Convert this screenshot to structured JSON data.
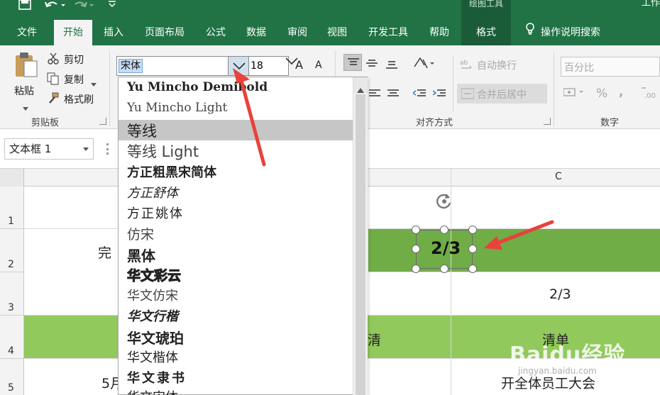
{
  "titlebar": {
    "context_title": "绘图工具",
    "window_title": "工作"
  },
  "tabs": [
    {
      "label": "文件"
    },
    {
      "label": "开始"
    },
    {
      "label": "插入"
    },
    {
      "label": "页面布局"
    },
    {
      "label": "公式"
    },
    {
      "label": "数据"
    },
    {
      "label": "审阅"
    },
    {
      "label": "视图"
    },
    {
      "label": "开发工具"
    },
    {
      "label": "帮助"
    },
    {
      "label": "格式"
    }
  ],
  "tell_me": "操作说明搜索",
  "ribbon": {
    "paste_label": "粘贴",
    "cut_label": "剪切",
    "copy_label": "复制",
    "format_painter_label": "格式刷",
    "clipboard_group": "剪贴板",
    "font_name": "宋体",
    "font_size": "18",
    "grow_font": "A",
    "shrink_font": "A",
    "wrap_text_label": "自动换行",
    "merge_center_label": "合并后居中",
    "alignment_group": "对齐方式",
    "number_format": "百分比",
    "percent_symbol": "%",
    "comma_symbol": ",",
    "number_group": "数字"
  },
  "name_box": "文本框 1",
  "sheet": {
    "column_label": "C",
    "row_labels": [
      "1",
      "2",
      "3",
      "4",
      "5"
    ],
    "cell_a2": "完",
    "cell_c3": "2/3",
    "cell_b4": "清",
    "cell_c4": "清单",
    "cell_a5": "5月",
    "cell_c5": "开全体员工大会"
  },
  "textbox_text": "2/3",
  "font_list": [
    "Yu Mincho Demibold",
    "Yu Mincho Light",
    "等线",
    "等线 Light",
    "方正粗黑宋简体",
    "方正舒体",
    "方正姚体",
    "仿宋",
    "黑体",
    "华文彩云",
    "华文仿宋",
    "华文行楷",
    "华文琥珀",
    "华文楷体",
    "华文隶书",
    "华文宋体"
  ],
  "selected_font_index": 2,
  "watermark": "Baidu经验",
  "watermark_sub": "jingyan.baidu.com",
  "colors": {
    "excel_green": "#217346",
    "header_fill": "#70ad47",
    "row4_fill": "#92c95c",
    "annotation_red": "#e8423a"
  }
}
